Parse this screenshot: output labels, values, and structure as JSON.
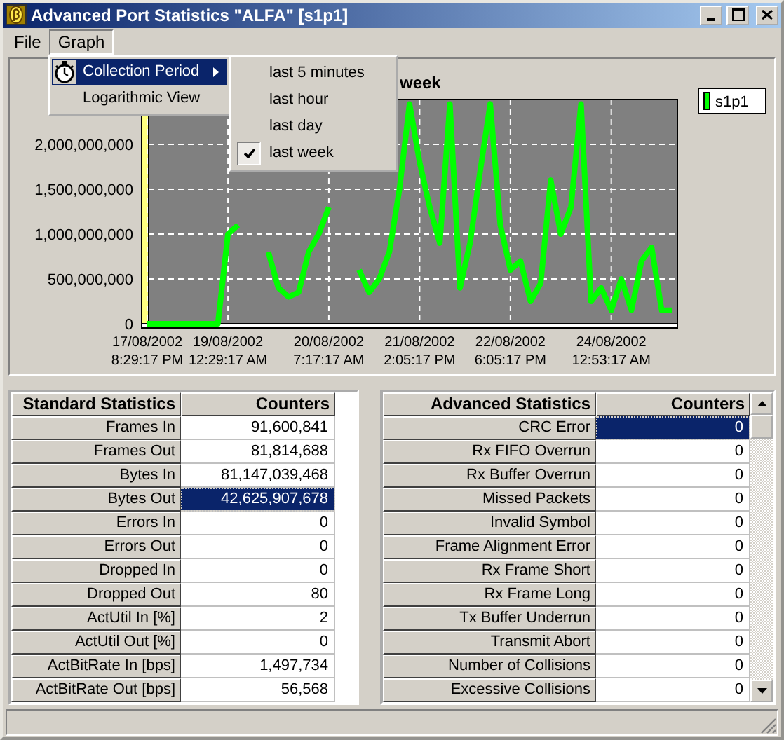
{
  "window": {
    "title": "Advanced Port Statistics \"ALFA\" [s1p1]"
  },
  "menu_bar": [
    {
      "label": "File",
      "selected": false
    },
    {
      "label": "Graph",
      "selected": true
    }
  ],
  "graph_menu": {
    "items": [
      {
        "label": "Collection Period",
        "selected": true,
        "kind": "submenu"
      },
      {
        "label": "Logarithmic View",
        "selected": false,
        "kind": "plain"
      }
    ]
  },
  "collection_period_menu": {
    "items": [
      {
        "label": "last 5 minutes",
        "checked": false
      },
      {
        "label": "last hour",
        "checked": false
      },
      {
        "label": "last day",
        "checked": false
      },
      {
        "label": "last week",
        "checked": true
      }
    ]
  },
  "chart": {
    "chart_data": {
      "type": "line",
      "title": "week",
      "grid": true,
      "ylim": [
        0,
        2500000000
      ],
      "yticks": [
        {
          "value": 0,
          "label": "0"
        },
        {
          "value": 500000000,
          "label": "500,000,000"
        },
        {
          "value": 1000000000,
          "label": "1,000,000,000"
        },
        {
          "value": 1500000000,
          "label": "1,500,000,000"
        },
        {
          "value": 2000000000,
          "label": "2,000,000,000"
        }
      ],
      "categories": [
        "17/08/2002\n8:29:17 PM",
        null,
        null,
        null,
        null,
        null,
        null,
        null,
        "19/08/2002\n12:29:17 AM",
        null,
        null,
        null,
        null,
        null,
        null,
        null,
        null,
        null,
        "20/08/2002\n7:17:17 AM",
        null,
        null,
        null,
        null,
        null,
        null,
        null,
        null,
        "21/08/2002\n2:05:17 PM",
        null,
        null,
        null,
        null,
        null,
        null,
        null,
        null,
        "22/08/2002\n6:05:17 PM",
        null,
        null,
        null,
        null,
        null,
        null,
        null,
        null,
        null,
        "24/08/2002\n12:53:17 AM",
        null,
        null,
        null,
        null,
        null,
        null
      ],
      "series": [
        {
          "name": "s1p1",
          "color": "#00ff00",
          "values": [
            0,
            0,
            0,
            0,
            0,
            0,
            0,
            0,
            1000000000.0,
            1100000000.0,
            null,
            null,
            800000000.0,
            400000000.0,
            300000000.0,
            350000000.0,
            800000000.0,
            1000000000.0,
            1300000000.0,
            null,
            null,
            600000000.0,
            350000000.0,
            500000000.0,
            800000000.0,
            1500000000.0,
            2450000000.0,
            1800000000.0,
            1300000000.0,
            900000000.0,
            2450000000.0,
            400000000.0,
            900000000.0,
            1700000000.0,
            2450000000.0,
            1100000000.0,
            600000000.0,
            700000000.0,
            250000000.0,
            450000000.0,
            1600000000.0,
            1000000000.0,
            1300000000.0,
            2450000000.0,
            250000000.0,
            400000000.0,
            150000000.0,
            500000000.0,
            150000000.0,
            700000000.0,
            850000000.0,
            150000000.0,
            150000000.0
          ]
        }
      ]
    }
  },
  "standard_table": {
    "columns": [
      "Standard Statistics",
      "Counters"
    ],
    "rows": [
      {
        "label": "Frames In",
        "value": "91,600,841",
        "selected": false
      },
      {
        "label": "Frames Out",
        "value": "81,814,688",
        "selected": false
      },
      {
        "label": "Bytes In",
        "value": "81,147,039,468",
        "selected": false
      },
      {
        "label": "Bytes Out",
        "value": "42,625,907,678",
        "selected": true
      },
      {
        "label": "Errors In",
        "value": "0",
        "selected": false
      },
      {
        "label": "Errors Out",
        "value": "0",
        "selected": false
      },
      {
        "label": "Dropped In",
        "value": "0",
        "selected": false
      },
      {
        "label": "Dropped Out",
        "value": "80",
        "selected": false
      },
      {
        "label": "ActUtil In [%]",
        "value": "2",
        "selected": false
      },
      {
        "label": "ActUtil Out [%]",
        "value": "0",
        "selected": false
      },
      {
        "label": "ActBitRate In [bps]",
        "value": "1,497,734",
        "selected": false
      },
      {
        "label": "ActBitRate Out [bps]",
        "value": "56,568",
        "selected": false
      }
    ]
  },
  "advanced_table": {
    "columns": [
      "Advanced Statistics",
      "Counters"
    ],
    "rows": [
      {
        "label": "CRC Error",
        "value": "0",
        "selected": true
      },
      {
        "label": "Rx FIFO Overrun",
        "value": "0",
        "selected": false
      },
      {
        "label": "Rx Buffer Overrun",
        "value": "0",
        "selected": false
      },
      {
        "label": "Missed Packets",
        "value": "0",
        "selected": false
      },
      {
        "label": "Invalid Symbol",
        "value": "0",
        "selected": false
      },
      {
        "label": "Frame Alignment Error",
        "value": "0",
        "selected": false
      },
      {
        "label": "Rx Frame Short",
        "value": "0",
        "selected": false
      },
      {
        "label": "Rx Frame Long",
        "value": "0",
        "selected": false
      },
      {
        "label": "Tx Buffer Underrun",
        "value": "0",
        "selected": false
      },
      {
        "label": "Transmit Abort",
        "value": "0",
        "selected": false
      },
      {
        "label": "Number of Collisions",
        "value": "0",
        "selected": false
      },
      {
        "label": "Excessive Collisions",
        "value": "0",
        "selected": false
      }
    ]
  }
}
